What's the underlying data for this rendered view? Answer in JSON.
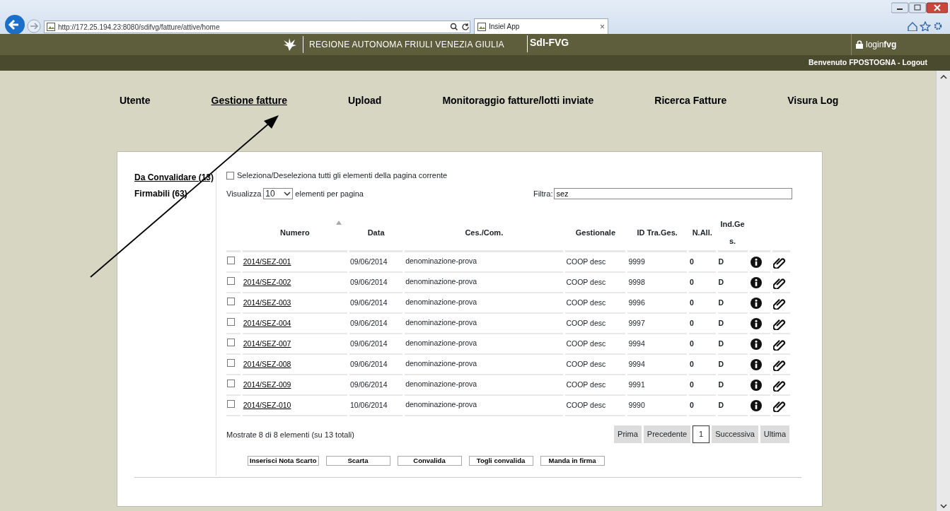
{
  "browser": {
    "address": "http://172.25.194.23:8080/sdifvg/fatture/attive/home",
    "tab_title": "Insiel App",
    "tab_close": "×"
  },
  "header": {
    "region": "REGIONE AUTONOMA FRIULI VENEZIA GIULIA",
    "app": "SdI-FVG",
    "login": "login**fvg**",
    "welcome": "Benvenuto FPOSTOGNA - Logout"
  },
  "nav": [
    {
      "label": "Utente",
      "selected": false
    },
    {
      "label": "Gestione fatture",
      "selected": true
    },
    {
      "label": "Upload",
      "selected": false
    },
    {
      "label": "Monitoraggio fatture/lotti inviate",
      "selected": false
    },
    {
      "label": "Ricerca Fatture",
      "selected": false
    },
    {
      "label": "Visura Log",
      "selected": false
    }
  ],
  "sidebar": [
    {
      "label": "Da Convalidare (13)",
      "selected": true
    },
    {
      "label": "Firmabili (63)",
      "selected": false
    }
  ],
  "select_all": {
    "label": "Seleziona/Deseleziona tutti gli elementi della pagina corrente",
    "checked": false
  },
  "page_size": {
    "prefix": "Visualizza",
    "value": "10",
    "suffix": "elementi per pagina"
  },
  "filter": {
    "label": "Filtra:",
    "value": "sez"
  },
  "table": {
    "columns": [
      "Numero",
      "Data",
      "Ces./Com.",
      "Gestionale",
      "ID Tra.Ges.",
      "N.All.",
      "Ind.Ges."
    ],
    "rows": [
      {
        "checked": false,
        "cells": [
          "2014/SEZ-001",
          "09/06/2014",
          "denominazione-prova",
          "COOP desc",
          "9999",
          "0",
          "D"
        ]
      },
      {
        "checked": false,
        "cells": [
          "2014/SEZ-002",
          "09/06/2014",
          "denominazione-prova",
          "COOP desc",
          "9998",
          "0",
          "D"
        ]
      },
      {
        "checked": false,
        "cells": [
          "2014/SEZ-003",
          "09/06/2014",
          "denominazione-prova",
          "COOP desc",
          "9996",
          "0",
          "D"
        ]
      },
      {
        "checked": false,
        "cells": [
          "2014/SEZ-004",
          "09/06/2014",
          "denominazione-prova",
          "COOP desc",
          "9997",
          "0",
          "D"
        ]
      },
      {
        "checked": false,
        "cells": [
          "2014/SEZ-007",
          "09/06/2014",
          "denominazione-prova",
          "COOP desc",
          "9994",
          "0",
          "D"
        ]
      },
      {
        "checked": false,
        "cells": [
          "2014/SEZ-008",
          "09/06/2014",
          "denominazione-prova",
          "COOP desc",
          "9994",
          "0",
          "D"
        ]
      },
      {
        "checked": false,
        "cells": [
          "2014/SEZ-009",
          "09/06/2014",
          "denominazione-prova",
          "COOP desc",
          "9991",
          "0",
          "D"
        ]
      },
      {
        "checked": false,
        "cells": [
          "2014/SEZ-010",
          "10/06/2014",
          "denominazione-prova",
          "COOP desc",
          "9990",
          "0",
          "D"
        ]
      }
    ]
  },
  "summary": "Mostrate 8 di 8 elementi (su 13 totali)",
  "pagination": [
    {
      "label": "Prima",
      "selected": false
    },
    {
      "label": "Precedente",
      "selected": false
    },
    {
      "label": "1",
      "selected": true
    },
    {
      "label": "Successiva",
      "selected": false
    },
    {
      "label": "Ultima",
      "selected": false
    }
  ],
  "actions": [
    "Inserisci Nota Scarto",
    "Scarta",
    "Convalida",
    "Togli convalida",
    "Manda in firma"
  ]
}
